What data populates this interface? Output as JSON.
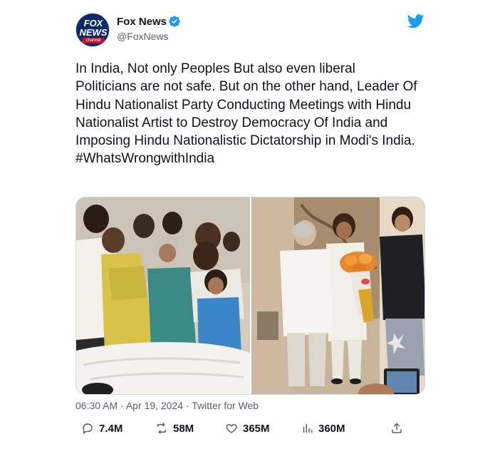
{
  "author": {
    "name": "Fox News",
    "handle": "@FoxNews",
    "avatar_lines": [
      "FOX",
      "NEWS",
      "channel"
    ],
    "verified_color": "#1d9bf0"
  },
  "tweet": {
    "text": "In India, Not only Peoples But also even liberal Politicians are not safe. But on the other hand, Leader Of Hindu Nationalist Party Conducting Meetings with Hindu Nationalist Artist to Destroy Democracy Of India and Imposing Hindu Nationalistic Dictatorship in Modi's India.",
    "hashtag": "#WhatsWrongwithIndia"
  },
  "meta": {
    "time": "06:30 AM",
    "separator": "·",
    "date": "Apr 19, 2024",
    "source": "Twitter for Web"
  },
  "actions": {
    "replies": "7.4M",
    "retweets": "58M",
    "likes": "365M",
    "views": "360M"
  },
  "colors": {
    "twitter_blue": "#1d9bf0",
    "text": "#0f1419",
    "muted": "#536471"
  }
}
